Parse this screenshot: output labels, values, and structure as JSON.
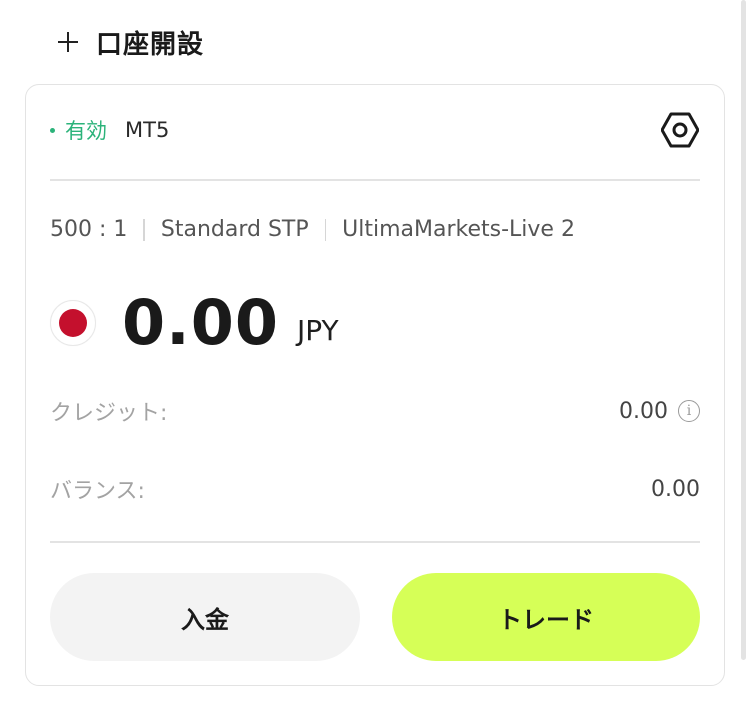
{
  "header": {
    "open_account_label": "口座開設"
  },
  "account": {
    "status": "有効",
    "platform": "MT5",
    "leverage": "500 : 1",
    "account_type": "Standard STP",
    "server": "UltimaMarkets-Live 2",
    "balance": "0.00",
    "currency": "JPY",
    "currency_flag": "japan-flag-icon",
    "credit_label": "クレジット:",
    "credit_value": "0.00",
    "balance_label": "バランス:",
    "balance_value": "0.00"
  },
  "actions": {
    "deposit_label": "入金",
    "trade_label": "トレード"
  },
  "colors": {
    "status_green": "#2bb37a",
    "trade_button": "#d6ff57",
    "deposit_button": "#f3f3f3",
    "flag_red": "#c4102d"
  }
}
